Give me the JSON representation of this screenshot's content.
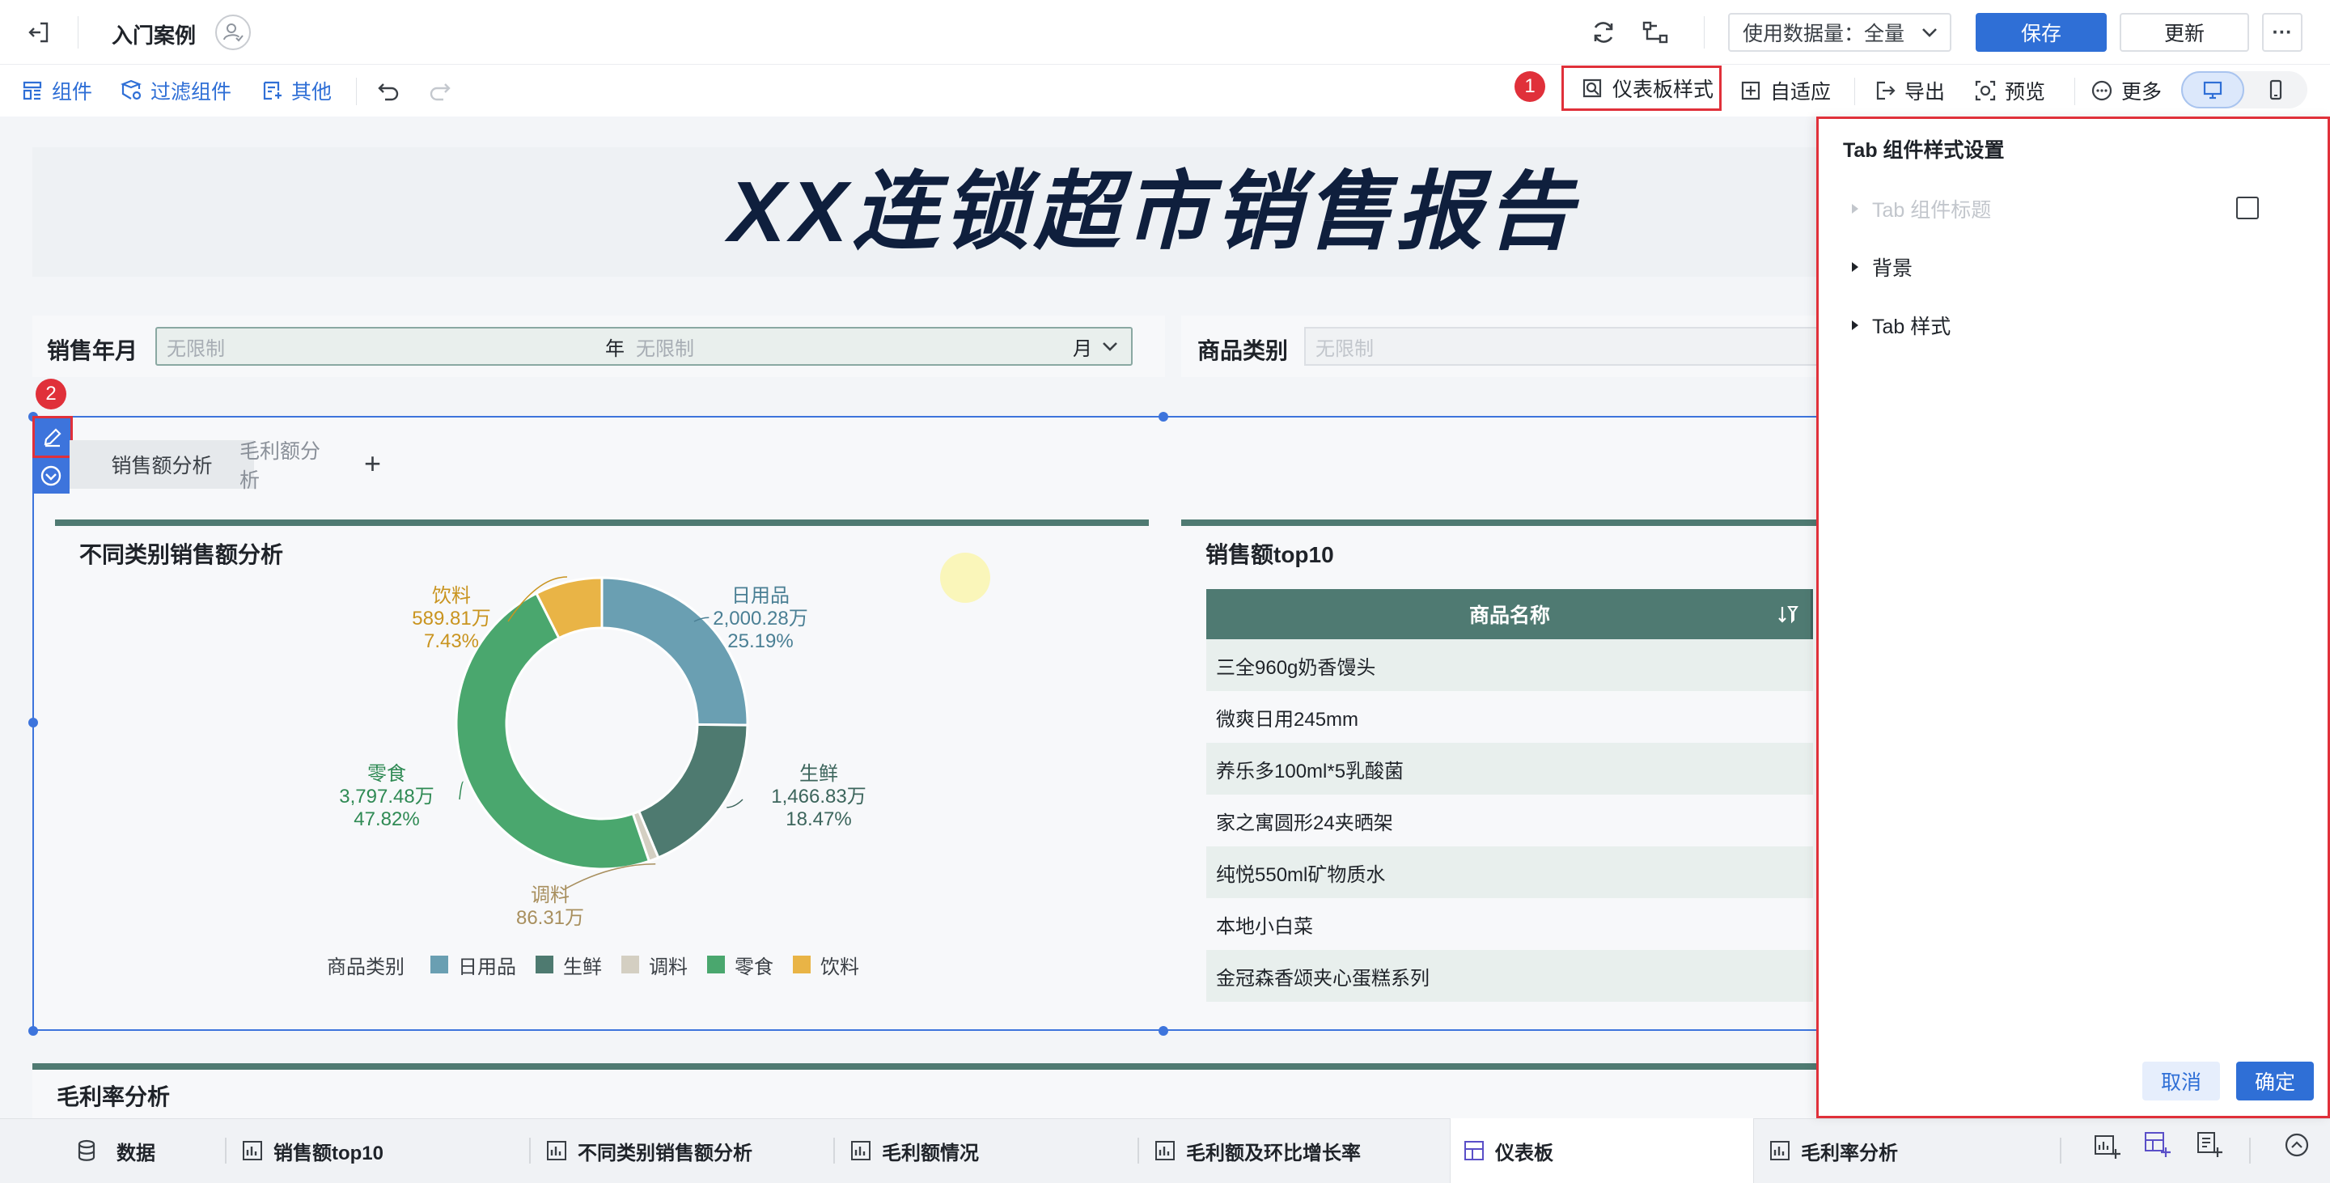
{
  "topbar": {
    "title": "入门案例",
    "data_usage_label": "使用数据量：",
    "data_usage_value": "全量",
    "save_label": "保存",
    "update_label": "更新",
    "more_label": "···"
  },
  "toolbar": {
    "component_label": "组件",
    "filter_component_label": "过滤组件",
    "other_label": "其他",
    "dashboard_style_label": "仪表板样式",
    "adaptive_label": "自适应",
    "export_label": "导出",
    "preview_label": "预览",
    "more_label": "更多"
  },
  "markers": {
    "one": "1",
    "two": "2"
  },
  "report": {
    "title": "XX连锁超市销售报告"
  },
  "filters": {
    "sales_month_label": "销售年月",
    "year_placeholder": "无限制",
    "year_unit": "年",
    "month_placeholder": "无限制",
    "month_unit": "月",
    "category_label": "商品类别",
    "category_placeholder": "无限制"
  },
  "tabs": {
    "items": [
      {
        "label": "销售额分析"
      },
      {
        "label": "毛利额分析"
      }
    ],
    "add_label": "+"
  },
  "donut": {
    "title": "不同类别销售额分析",
    "legend_title": "商品类别",
    "slices": [
      {
        "name": "日用品",
        "value": "2,000.28万",
        "pct": "25.19%",
        "color": "#6a9fb2"
      },
      {
        "name": "生鲜",
        "value": "1,466.83万",
        "pct": "18.47%",
        "color": "#4e7a70"
      },
      {
        "name": "调料",
        "value": "86.31万",
        "color": "#d4cfc2"
      },
      {
        "name": "零食",
        "value": "3,797.48万",
        "pct": "47.82%",
        "color": "#4aa76e"
      },
      {
        "name": "饮料",
        "value": "589.81万",
        "pct": "7.43%",
        "color": "#e9b446"
      }
    ]
  },
  "chart_data": {
    "type": "pie",
    "title": "不同类别销售额分析",
    "legend_title": "商品类别",
    "legend_position": "bottom",
    "unit": "万",
    "categories": [
      "日用品",
      "生鲜",
      "调料",
      "零食",
      "饮料"
    ],
    "values": [
      2000.28,
      1466.83,
      86.31,
      3797.48,
      589.81
    ],
    "percent_labels": [
      25.19,
      18.47,
      null,
      47.82,
      7.43
    ]
  },
  "top10": {
    "title": "销售额top10",
    "column_header": "商品名称",
    "rows": [
      "三全960g奶香馒头",
      "微爽日用245mm",
      "养乐多100ml*5乳酸菌",
      "家之寓圆形24夹晒架",
      "纯悦550ml矿物质水",
      "本地小白菜",
      "金冠森香颂夹心蛋糕系列"
    ]
  },
  "gross_margin": {
    "title": "毛利率分析"
  },
  "bottom_tabs": {
    "data_label": "数据",
    "items": [
      {
        "label": "销售额top10"
      },
      {
        "label": "不同类别销售额分析"
      },
      {
        "label": "毛利额情况"
      },
      {
        "label": "毛利额及环比增长率"
      },
      {
        "label": "仪表板"
      },
      {
        "label": "毛利率分析"
      }
    ]
  },
  "panel": {
    "title": "Tab 组件样式设置",
    "sections": [
      {
        "label": "Tab 组件标题"
      },
      {
        "label": "背景"
      },
      {
        "label": "Tab 样式"
      }
    ],
    "cancel_label": "取消",
    "confirm_label": "确定"
  },
  "colors": {
    "primary": "#2f6fd6",
    "header_green": "#4f7a72",
    "marker_red": "#e0303a",
    "title_navy": "#0f1f3d"
  },
  "icons": [
    "exit-icon",
    "user-check-icon",
    "refresh-icon",
    "relation-icon",
    "chevron-down-icon",
    "component-icon",
    "filter-component-icon",
    "other-icon",
    "undo-icon",
    "redo-icon",
    "dashboard-style-icon",
    "adaptive-icon",
    "export-icon",
    "preview-icon",
    "more-circle-icon",
    "desktop-icon",
    "mobile-icon",
    "edit-icon",
    "collapse-icon",
    "sort-icon",
    "database-icon",
    "chart-icon",
    "dashboard-icon",
    "add-chart-icon",
    "add-dashboard-icon",
    "add-report-icon",
    "expand-up-icon",
    "checkbox-icon",
    "caret-right-icon"
  ]
}
